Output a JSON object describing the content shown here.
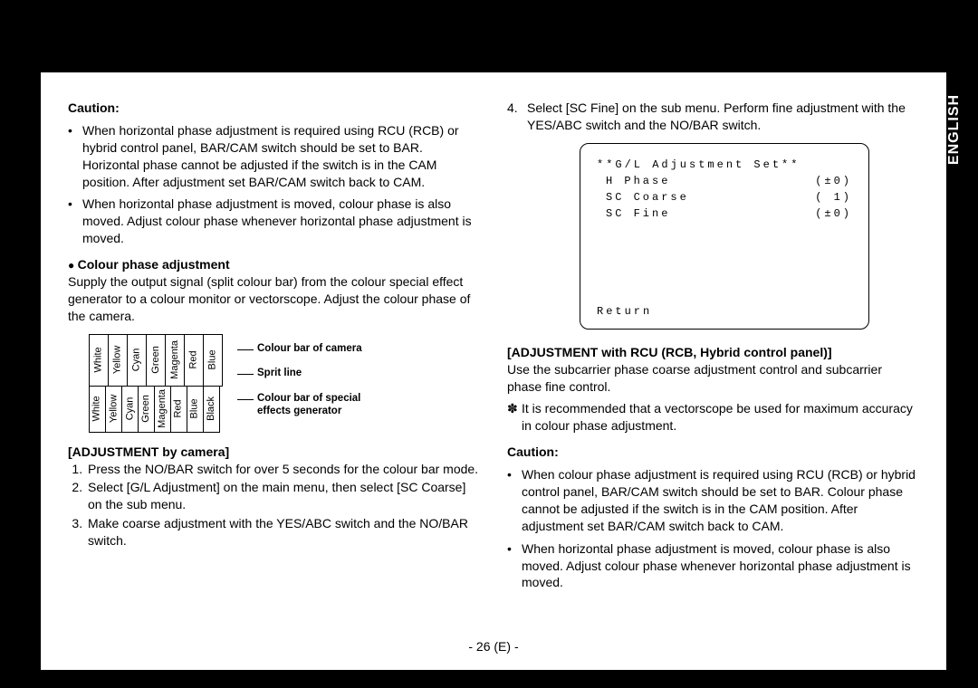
{
  "side_tab": "ENGLISH",
  "page_foot": "- 26 (E) -",
  "left": {
    "caution_heading": "Caution:",
    "caution_items": [
      "When horizontal phase adjustment is required using RCU (RCB) or hybrid control panel, BAR/CAM switch should be set to BAR. Horizontal phase cannot be adjusted if the switch is in the CAM position. After adjustment set BAR/CAM switch back to CAM.",
      "When horizontal phase adjustment is moved, colour phase is also moved. Adjust colour phase whenever horizontal phase adjustment is moved."
    ],
    "cpa_heading": "Colour phase adjustment",
    "cpa_body": "Supply the output signal (split colour bar) from the colour special effect generator to a colour monitor or vectorscope. Adjust the colour phase of the camera.",
    "cb_top": [
      "White",
      "Yellow",
      "Cyan",
      "Green",
      "Magenta",
      "Red",
      "Blue"
    ],
    "cb_bot": [
      "White",
      "Yellow",
      "Cyan",
      "Green",
      "Magenta",
      "Red",
      "Blue",
      "Black"
    ],
    "lab_top": "Colour bar of camera",
    "lab_mid": "Sprit line",
    "lab_bot1": "Colour bar of special",
    "lab_bot2": "effects generator",
    "adj_cam_heading": "[ADJUSTMENT by camera]",
    "adj_cam_steps": [
      "Press the NO/BAR switch for over 5 seconds for the colour bar mode.",
      "Select [G/L Adjustment] on the main menu, then select [SC Coarse] on the sub menu.",
      "Make coarse adjustment with the YES/ABC switch and the NO/BAR switch."
    ]
  },
  "right": {
    "step4_num": "4.",
    "step4": "Select [SC Fine] on the sub menu. Perform fine adjustment with the YES/ABC switch and the NO/BAR switch.",
    "osd": {
      "title": "**G/L Adjustment Set**",
      "rows": [
        {
          "l": "H Phase",
          "r": "(±0)"
        },
        {
          "l": "SC Coarse",
          "r": "( 1)"
        },
        {
          "l": "SC Fine",
          "r": "(±0)"
        }
      ],
      "return": "Return"
    },
    "adj_rcu_heading": "[ADJUSTMENT with RCU (RCB, Hybrid control panel)]",
    "adj_rcu_body": "Use the subcarrier phase coarse adjustment control and subcarrier phase fine control.",
    "note_mark": "✽",
    "note": "It is recommended that a vectorscope be used for maximum accuracy in colour phase adjustment.",
    "caution_heading": "Caution:",
    "caution_items": [
      "When colour phase adjustment is required using RCU (RCB) or hybrid control panel, BAR/CAM switch should be set to BAR. Colour phase cannot be adjusted if the switch is in the CAM position. After adjustment set BAR/CAM switch back to CAM.",
      "When horizontal phase adjustment is moved, colour phase is also moved. Adjust colour phase whenever horizontal phase adjustment is moved."
    ]
  }
}
